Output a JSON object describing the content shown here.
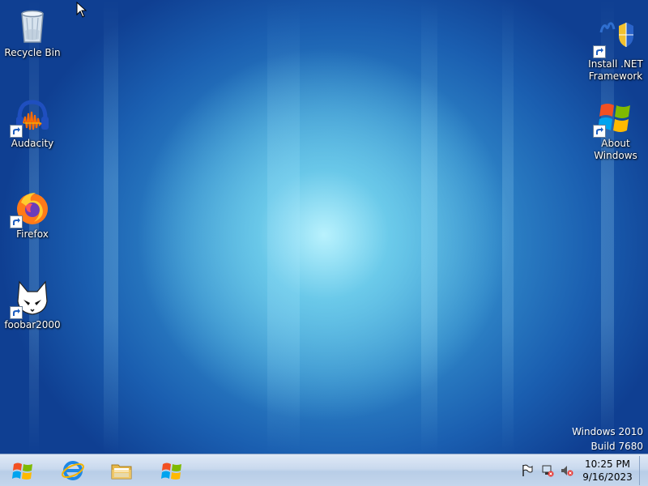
{
  "desktop_icons": [
    {
      "label": "Recycle Bin",
      "icon": "recycle-bin-icon",
      "shortcut": false
    },
    {
      "label": "Audacity",
      "icon": "audacity-icon",
      "shortcut": true
    },
    {
      "label": "Firefox",
      "icon": "firefox-icon",
      "shortcut": true
    },
    {
      "label": "foobar2000",
      "icon": "foobar2000-icon",
      "shortcut": true
    },
    {
      "label": "Install .NET\nFramework",
      "icon": "dotnet-installer-icon",
      "shortcut": true
    },
    {
      "label": "About\nWindows",
      "icon": "windows-logo-icon",
      "shortcut": true
    }
  ],
  "watermark": {
    "line1": "Windows 2010",
    "line2": "Build 7680"
  },
  "taskbar": {
    "pinned": [
      {
        "icon": "start-orb-icon"
      },
      {
        "icon": "internet-explorer-icon"
      },
      {
        "icon": "file-explorer-icon"
      },
      {
        "icon": "windows-logo-icon"
      }
    ],
    "tray_icons": [
      "action-center-flag-icon",
      "network-disconnected-icon",
      "volume-muted-icon"
    ],
    "clock": {
      "time": "10:25 PM",
      "date": "9/16/2023"
    }
  },
  "colors": {
    "desktop_dark": "#0f3f92",
    "desktop_glow": "#bef5ff",
    "taskbar": "#c9d9ee"
  }
}
